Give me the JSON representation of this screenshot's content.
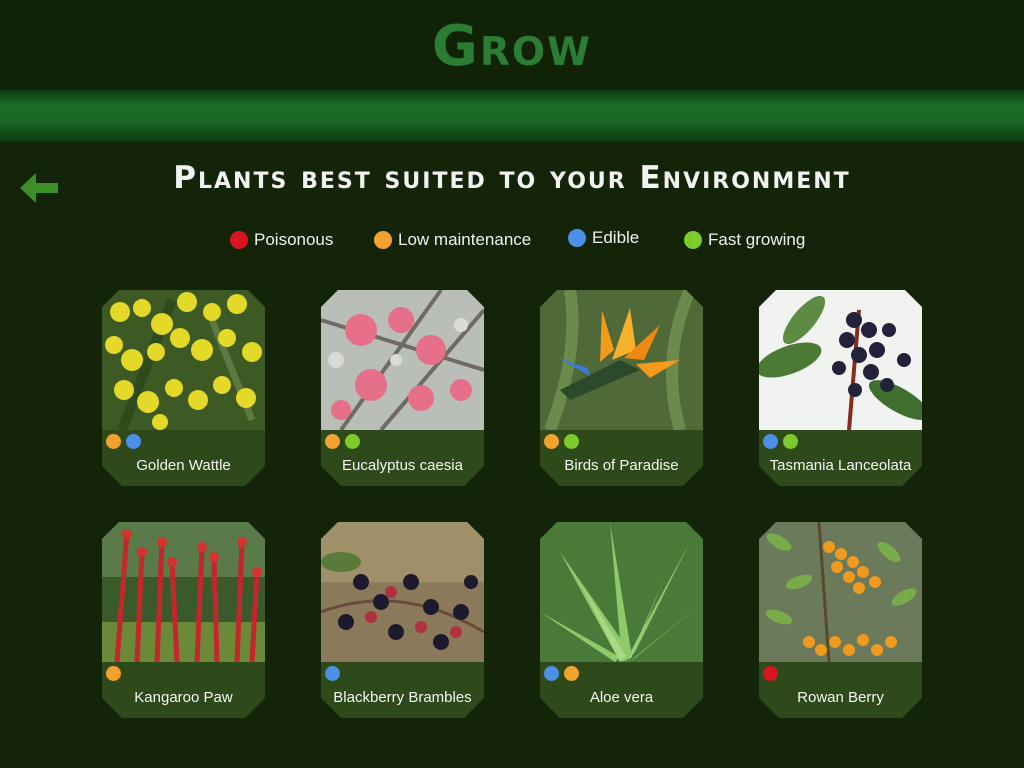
{
  "app": {
    "title": "Grow"
  },
  "page": {
    "title": "Plants best suited to your Environment"
  },
  "colors": {
    "poisonous": "#d7151f",
    "low_maintenance": "#f2a22e",
    "edible": "#4b8fe6",
    "fast_growing": "#7ccb2a",
    "brand_green": "#2b7d33"
  },
  "legend": [
    {
      "key": "poisonous",
      "label": "Poisonous"
    },
    {
      "key": "low_maintenance",
      "label": "Low maintenance"
    },
    {
      "key": "edible",
      "label": "Edible"
    },
    {
      "key": "fast_growing",
      "label": "Fast growing"
    }
  ],
  "back_icon": "arrow-left-icon",
  "plants": [
    {
      "name": "Golden Wattle",
      "tags": [
        "low_maintenance",
        "edible"
      ]
    },
    {
      "name": "Eucalyptus caesia",
      "tags": [
        "low_maintenance",
        "fast_growing"
      ]
    },
    {
      "name": "Birds of Paradise",
      "tags": [
        "low_maintenance",
        "fast_growing"
      ]
    },
    {
      "name": "Tasmania Lanceolata",
      "tags": [
        "edible",
        "fast_growing"
      ]
    },
    {
      "name": "Kangaroo Paw",
      "tags": [
        "low_maintenance"
      ]
    },
    {
      "name": "Blackberry Brambles",
      "tags": [
        "edible"
      ]
    },
    {
      "name": "Aloe vera",
      "tags": [
        "edible",
        "low_maintenance"
      ]
    },
    {
      "name": "Rowan Berry",
      "tags": [
        "poisonous"
      ]
    }
  ]
}
